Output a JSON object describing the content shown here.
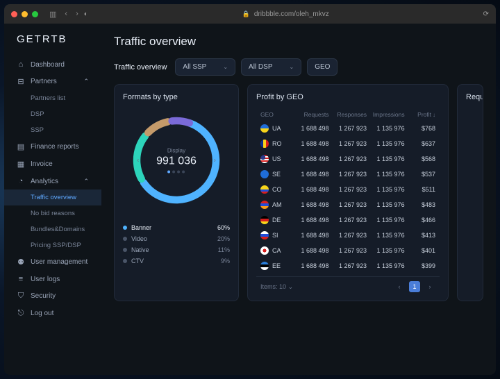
{
  "browser": {
    "url": "dribbble.com/oleh_mkvz"
  },
  "brand": "GETRTB",
  "nav": {
    "dashboard": "Dashboard",
    "partners": "Partners",
    "partners_list": "Partners list",
    "dsp": "DSP",
    "ssp": "SSP",
    "finance": "Finance reports",
    "invoice": "Invoice",
    "analytics": "Analytics",
    "traffic_overview": "Traffic overview",
    "no_bid": "No bid reasons",
    "bundles": "Bundles&Domains",
    "pricing": "Pricing SSP/DSP",
    "user_mgmt": "User management",
    "user_logs": "User logs",
    "security": "Security",
    "logout": "Log out"
  },
  "page_title": "Traffic overview",
  "filters": {
    "label": "Traffic overview",
    "ssp": "All SSP",
    "dsp": "All DSP",
    "geo": "GEO"
  },
  "formats": {
    "title": "Formats by type",
    "center_label": "Display",
    "center_value": "991 036",
    "legend": [
      {
        "name": "Banner",
        "pct": "60%",
        "color": "#4fb3ff",
        "active": true
      },
      {
        "name": "Video",
        "pct": "20%",
        "color": "#4a5568",
        "active": false
      },
      {
        "name": "Native",
        "pct": "11%",
        "color": "#4a5568",
        "active": false
      },
      {
        "name": "CTV",
        "pct": "9%",
        "color": "#4a5568",
        "active": false
      }
    ]
  },
  "geo": {
    "title": "Profit by GEO",
    "headers": {
      "geo": "GEO",
      "req": "Requests",
      "res": "Responses",
      "imp": "Impressions",
      "profit": "Profit"
    },
    "rows": [
      {
        "code": "UA",
        "flag": "linear-gradient(#1f6dd8 50%,#f7d51a 50%)",
        "req": "1 688 498",
        "res": "1 267 923",
        "imp": "1 135 976",
        "profit": "$768"
      },
      {
        "code": "RO",
        "flag": "linear-gradient(90deg,#0b2e8a 33%,#f9d01a 33% 66%,#d81e1e 66%)",
        "req": "1 688 498",
        "res": "1 267 923",
        "imp": "1 135 976",
        "profit": "$637"
      },
      {
        "code": "US",
        "flag": "radial-gradient(circle at 30% 30%,#2a3a8a 0 30%,transparent 30%),repeating-linear-gradient(#d81e1e 0 2px,#fff 2px 4px)",
        "req": "1 688 498",
        "res": "1 267 923",
        "imp": "1 135 976",
        "profit": "$568"
      },
      {
        "code": "SE",
        "flag": "linear-gradient(#1f6dd8,#1f6dd8)",
        "req": "1 688 498",
        "res": "1 267 923",
        "imp": "1 135 976",
        "profit": "$537"
      },
      {
        "code": "CO",
        "flag": "linear-gradient(#f7d51a 50%,#1f4dd8 50% 75%,#d81e1e 75%)",
        "req": "1 688 498",
        "res": "1 267 923",
        "imp": "1 135 976",
        "profit": "$511"
      },
      {
        "code": "AM",
        "flag": "linear-gradient(#d81e1e 33%,#1f4dd8 33% 66%,#f79a1a 66%)",
        "req": "1 688 498",
        "res": "1 267 923",
        "imp": "1 135 976",
        "profit": "$483"
      },
      {
        "code": "DE",
        "flag": "linear-gradient(#000 33%,#d81e1e 33% 66%,#f7d51a 66%)",
        "req": "1 688 498",
        "res": "1 267 923",
        "imp": "1 135 976",
        "profit": "$466"
      },
      {
        "code": "SI",
        "flag": "linear-gradient(#fff 33%,#1f4dd8 33% 66%,#d81e1e 66%)",
        "req": "1 688 498",
        "res": "1 267 923",
        "imp": "1 135 976",
        "profit": "$413"
      },
      {
        "code": "CA",
        "flag": "radial-gradient(circle,#d81e1e 0 30%,#fff 30%)",
        "req": "1 688 498",
        "res": "1 267 923",
        "imp": "1 135 976",
        "profit": "$401"
      },
      {
        "code": "EE",
        "flag": "linear-gradient(#2a7dd8 33%,#000 33% 66%,#fff 66%)",
        "req": "1 688 498",
        "res": "1 267 923",
        "imp": "1 135 976",
        "profit": "$399"
      }
    ],
    "items_label": "Items:",
    "items_value": "10",
    "page": "1"
  },
  "req_panel": {
    "title": "Reque"
  },
  "chart_data": {
    "type": "pie",
    "title": "Formats by type",
    "center_label": "Display",
    "center_value": 991036,
    "series": [
      {
        "name": "Banner",
        "value": 60,
        "color": "#4fb3ff"
      },
      {
        "name": "Video",
        "value": 20,
        "color": "#2dd4bb"
      },
      {
        "name": "Native",
        "value": 11,
        "color": "#c49a6a"
      },
      {
        "name": "CTV",
        "value": 9,
        "color": "#7a6ad8"
      }
    ]
  }
}
